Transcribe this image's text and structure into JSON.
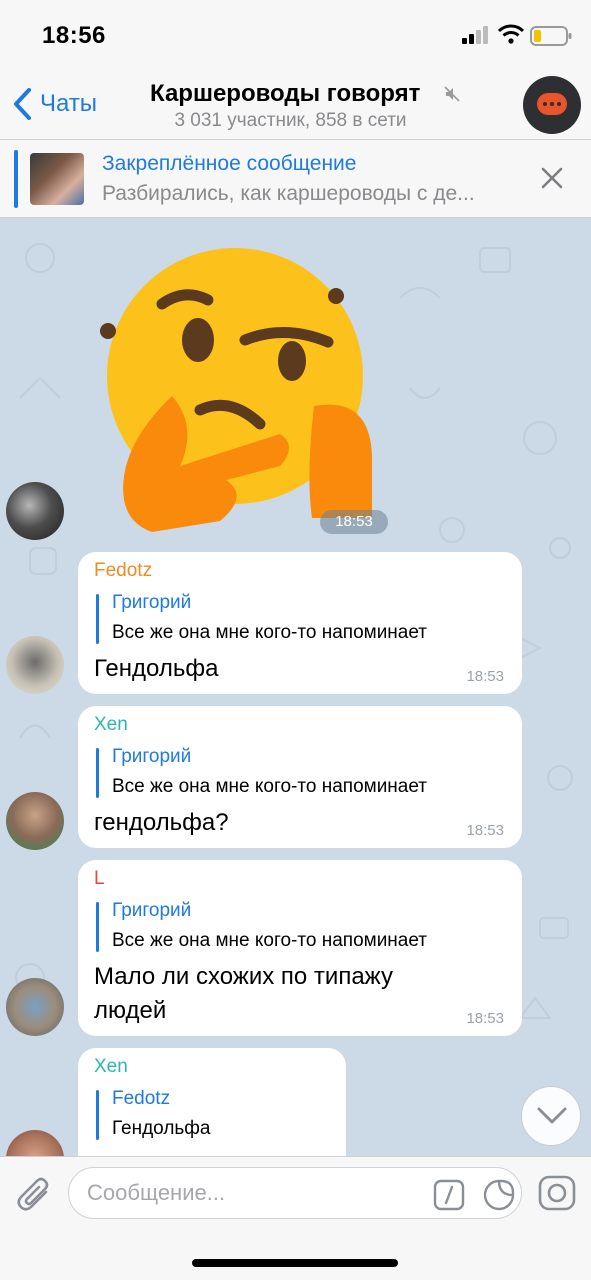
{
  "status_bar": {
    "time": "18:56"
  },
  "nav": {
    "back_label": "Чаты",
    "title": "Каршероводы говорят",
    "subtitle": "3 031 участник, 858 в сети"
  },
  "pinned": {
    "title": "Закреплённое сообщение",
    "text": "Разбирались, как каршероводы с де..."
  },
  "sticker": {
    "time": "18:53"
  },
  "messages": [
    {
      "sender": "Fedotz",
      "sender_color": "#f08a24",
      "reply_name": "Григорий",
      "reply_text": "Все же она мне  кого-то напоминает",
      "text": "Гендольфа",
      "time": "18:53"
    },
    {
      "sender": "Xen",
      "sender_color": "#2fb5b0",
      "reply_name": "Григорий",
      "reply_text": "Все же она мне  кого-то напоминает",
      "text": "гендольфа?",
      "time": "18:53"
    },
    {
      "sender": "L",
      "sender_color": "#e5483f",
      "reply_name": "Григорий",
      "reply_text": "Все же она мне  кого-то напоминает",
      "text_line1": "Мало ли схожих по типажу",
      "text_line2": "людей",
      "time": "18:53"
    },
    {
      "sender": "Xen",
      "sender_color": "#2fb5b0",
      "reply_name": "Fedotz",
      "reply_text": "Гендольфа"
    }
  ],
  "input": {
    "placeholder": "Сообщение..."
  },
  "colors": {
    "accent": "#1f7ae0",
    "chat_bg": "#ccd9e6"
  }
}
